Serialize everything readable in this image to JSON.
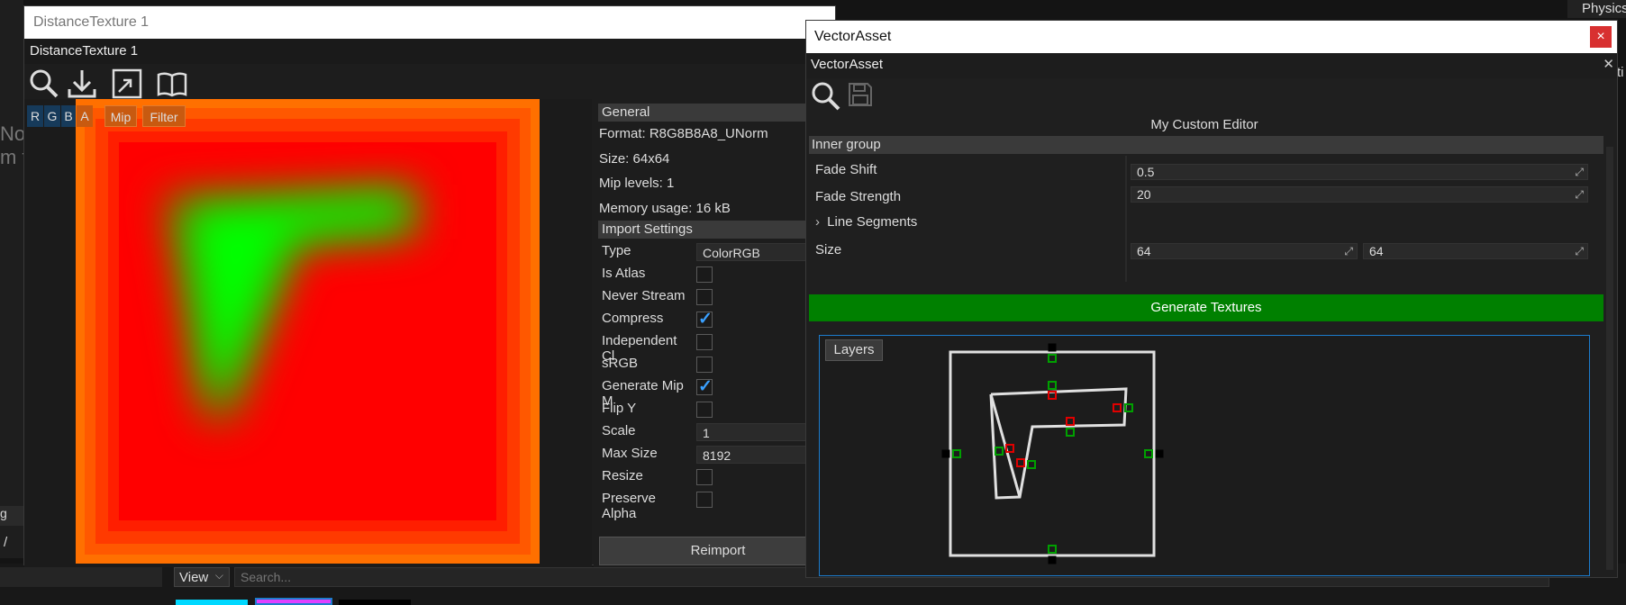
{
  "background": {
    "left_text_lines": [
      "No",
      "m t"
    ],
    "left_side_chars": [
      "g",
      "/"
    ],
    "right_top_tab": "Physics",
    "right_side_char": "ti",
    "content_bar": {
      "view_label": "View",
      "search_placeholder": "Search..."
    }
  },
  "distance_texture": {
    "window_title": "DistanceTexture 1",
    "tab_title": "DistanceTexture 1",
    "toolbar_icons": [
      "search-icon",
      "download-icon",
      "resize-icon",
      "book-icon"
    ],
    "channel_buttons": [
      {
        "label": "R",
        "color": "#163a5a"
      },
      {
        "label": "G",
        "color": "#163a5a"
      },
      {
        "label": "B",
        "color": "#163a5a"
      },
      {
        "label": "A",
        "color": "#c85a10"
      },
      {
        "label": "Mip",
        "color": "#c85a10"
      },
      {
        "label": "Filter",
        "color": "#c85a10"
      }
    ],
    "general": {
      "header": "General",
      "format": "Format: R8G8B8A8_UNorm",
      "size": "Size: 64x64",
      "mip_levels": "Mip levels: 1",
      "memory": "Memory usage: 16 kB"
    },
    "import_settings": {
      "header": "Import Settings",
      "rows": [
        {
          "label": "Type",
          "kind": "field",
          "value": "ColorRGB"
        },
        {
          "label": "Is Atlas",
          "kind": "check",
          "checked": false
        },
        {
          "label": "Never Stream",
          "kind": "check",
          "checked": false
        },
        {
          "label": "Compress",
          "kind": "check",
          "checked": true
        },
        {
          "label": "Independent Cl",
          "kind": "check",
          "checked": false
        },
        {
          "label": "sRGB",
          "kind": "check",
          "checked": false
        },
        {
          "label": "Generate Mip M",
          "kind": "check",
          "checked": true
        },
        {
          "label": "Flip Y",
          "kind": "check",
          "checked": false
        },
        {
          "label": "Scale",
          "kind": "field",
          "value": "1"
        },
        {
          "label": "Max Size",
          "kind": "field",
          "value": "8192"
        },
        {
          "label": "Resize",
          "kind": "check",
          "checked": false
        },
        {
          "label": "Preserve Alpha",
          "kind": "check",
          "checked": false
        }
      ]
    },
    "reimport_label": "Reimport",
    "colors": {
      "outer": "#ff6a00",
      "mid": "#ff0000",
      "glow": "#00ff00"
    }
  },
  "vector_asset": {
    "window_title": "VectorAsset",
    "close_symbol": "×",
    "tab_title": "VectorAsset",
    "tab_close": "✕",
    "toolbar_icons": [
      "search-icon",
      "save-icon"
    ],
    "editor_title": "My Custom Editor",
    "inner_group": "Inner group",
    "fade_shift": {
      "label": "Fade Shift",
      "value": "0.5"
    },
    "fade_strength": {
      "label": "Fade Strength",
      "value": "20"
    },
    "line_segments": "Line Segments",
    "size": {
      "label": "Size",
      "x": "64",
      "y": "64"
    },
    "generate_label": "Generate Textures",
    "layers_label": "Layers",
    "colors": {
      "generate": "#008000",
      "accent": "#1c7ccc",
      "handle_red": "#e00000",
      "handle_green": "#00a000"
    }
  }
}
